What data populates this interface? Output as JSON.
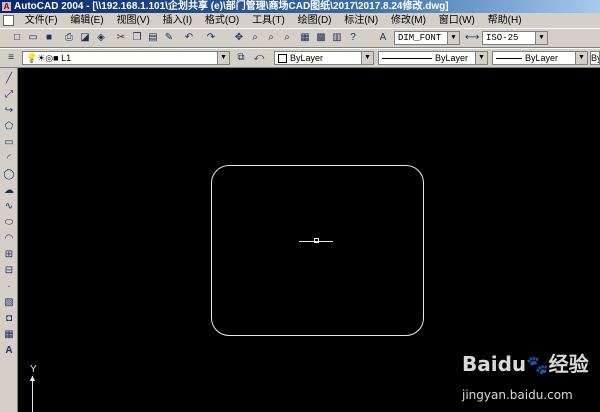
{
  "window": {
    "title": "AutoCAD 2004 - [\\\\192.168.1.101\\企划共享 (e)\\部门管理\\商场CAD图纸\\2017\\2017.8.24修改.dwg]"
  },
  "menu": {
    "items": [
      "文件(F)",
      "编辑(E)",
      "视图(V)",
      "插入(I)",
      "格式(O)",
      "工具(T)",
      "绘图(D)",
      "标注(N)",
      "修改(M)",
      "窗口(W)",
      "帮助(H)"
    ]
  },
  "toolbar_standard": {
    "text_style": "DIM_FONT",
    "dim_style": "ISO-25"
  },
  "toolbar_properties": {
    "layer": "L1",
    "color": "ByLayer",
    "linetype": "ByLayer",
    "lineweight": "ByLayer",
    "plot_style": "ByC"
  },
  "canvas": {
    "ucs_label": "Y"
  },
  "watermark": {
    "brand": "Baidu",
    "suffix": "经验",
    "url": "jingyan.baidu.com"
  }
}
